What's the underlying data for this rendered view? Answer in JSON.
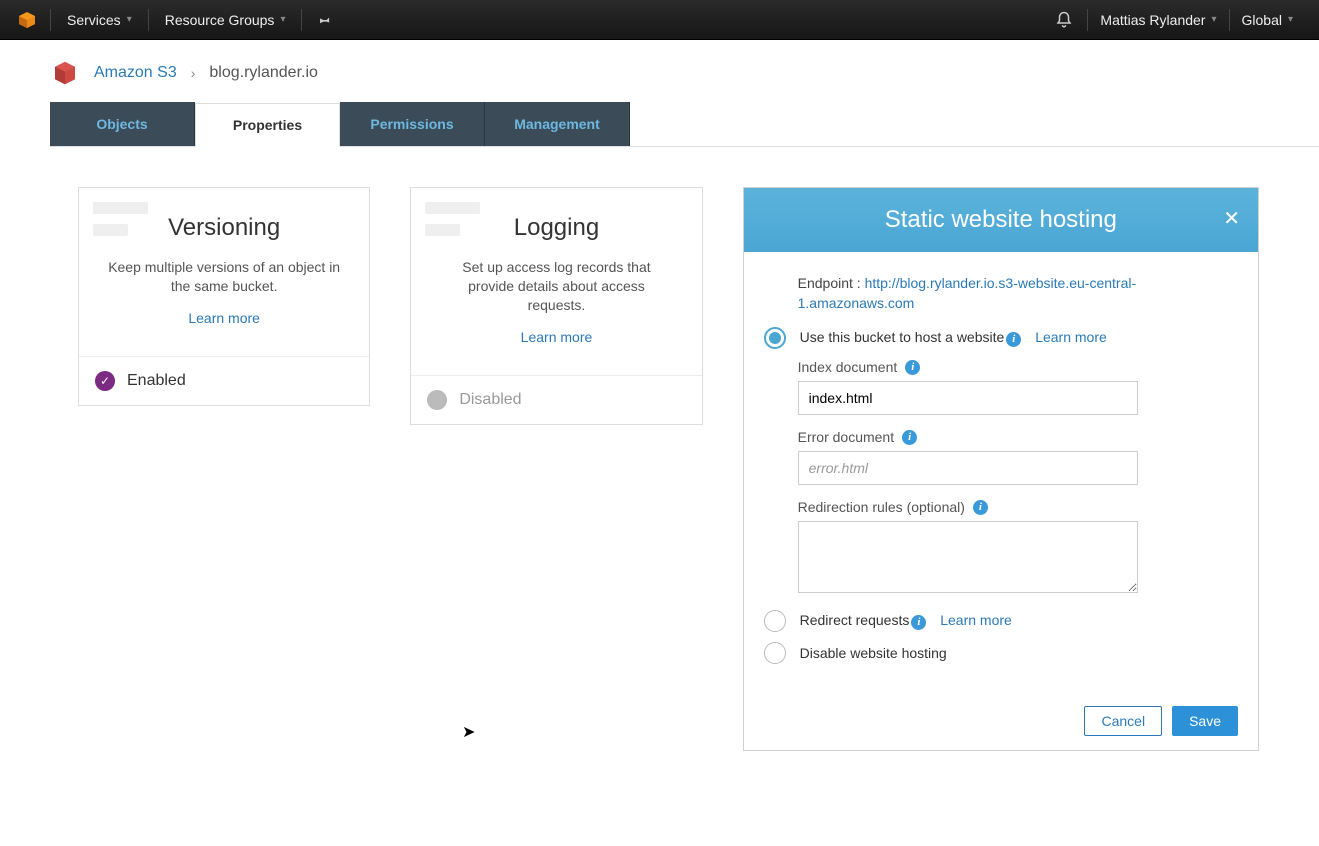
{
  "topbar": {
    "services": "Services",
    "resource_groups": "Resource Groups",
    "user": "Mattias Rylander",
    "region": "Global"
  },
  "breadcrumb": {
    "root": "Amazon S3",
    "current": "blog.rylander.io"
  },
  "tabs": {
    "objects": "Objects",
    "properties": "Properties",
    "permissions": "Permissions",
    "management": "Management"
  },
  "cards": {
    "versioning": {
      "title": "Versioning",
      "desc": "Keep multiple versions of an object in the same bucket.",
      "learn": "Learn more",
      "status": "Enabled"
    },
    "logging": {
      "title": "Logging",
      "desc": "Set up access log records that provide details about access requests.",
      "learn": "Learn more",
      "status": "Disabled"
    }
  },
  "panel": {
    "title": "Static website hosting",
    "endpoint_label": "Endpoint : ",
    "endpoint_url": "http://blog.rylander.io.s3-website.eu-central-1.amazonaws.com",
    "options": {
      "host": "Use this bucket to host a website",
      "redirect": "Redirect requests",
      "disable": "Disable website hosting"
    },
    "learn_more": "Learn more",
    "fields": {
      "index_label": "Index document",
      "index_value": "index.html",
      "error_label": "Error document",
      "error_placeholder": "error.html",
      "rules_label": "Redirection rules (optional)"
    },
    "buttons": {
      "cancel": "Cancel",
      "save": "Save"
    }
  }
}
